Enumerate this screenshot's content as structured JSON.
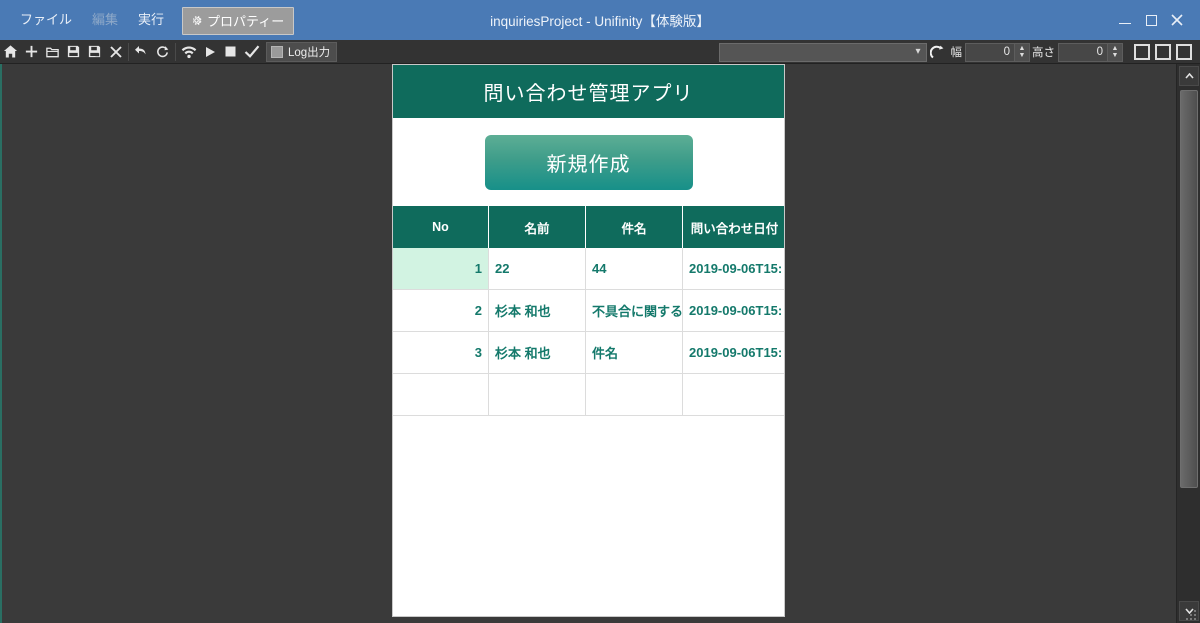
{
  "window": {
    "title": "inquiriesProject - Unifinity【体験版】",
    "accent_color": "#4a7ab5",
    "controls": {
      "minimize": "minimize",
      "maximize": "maximize",
      "close": "close"
    }
  },
  "menubar": {
    "items": [
      {
        "label": "ファイル",
        "enabled": true
      },
      {
        "label": "編集",
        "enabled": false
      },
      {
        "label": "実行",
        "enabled": true
      }
    ],
    "active_button": {
      "label": "プロパティー",
      "icon": "gear-icon"
    }
  },
  "toolbar": {
    "icons": [
      {
        "name": "home-icon",
        "title": "ホーム"
      },
      {
        "name": "plus-icon",
        "title": "新規"
      },
      {
        "name": "folder-icon",
        "title": "開く"
      },
      {
        "name": "save-icon",
        "title": "保存"
      },
      {
        "name": "save-as-icon",
        "title": "名前を付けて保存"
      },
      {
        "name": "close-icon",
        "title": "閉じる"
      },
      {
        "name": "undo-icon",
        "title": "元に戻す"
      },
      {
        "name": "reload-icon",
        "title": "やり直し"
      },
      {
        "name": "wifi-icon",
        "title": "接続"
      },
      {
        "name": "play-icon",
        "title": "実行"
      },
      {
        "name": "stop-icon",
        "title": "停止"
      },
      {
        "name": "check-icon",
        "title": "チェック"
      }
    ],
    "log_button": {
      "label": "Log出力",
      "checked": false
    },
    "dropdown": {
      "value": "",
      "caret": "chevron-down-icon"
    },
    "rotate_icon": "rotate-icon",
    "width_field": {
      "label": "幅",
      "value": "0"
    },
    "height_field": {
      "label": "高さ",
      "value": "0"
    },
    "layout_buttons": [
      "layout-button-1",
      "layout-button-2",
      "layout-button-3"
    ]
  },
  "preview": {
    "header_title": "問い合わせ管理アプリ",
    "header_color": "#0f6b5c",
    "new_button_label": "新規作成",
    "table": {
      "columns": [
        "No",
        "名前",
        "件名",
        "問い合わせ日付"
      ],
      "rows": [
        {
          "no": "1",
          "name": "22",
          "subject": "44",
          "date": "2019-09-06T15:",
          "selected": true
        },
        {
          "no": "2",
          "name": "杉本 和也",
          "subject": "不具合に関する|",
          "date": "2019-09-06T15:",
          "selected": false
        },
        {
          "no": "3",
          "name": "杉本 和也",
          "subject": "件名",
          "date": "2019-09-06T15:",
          "selected": false
        },
        {
          "no": "",
          "name": "",
          "subject": "",
          "date": "",
          "selected": false
        }
      ]
    }
  },
  "scrollbar": {
    "up_arrow": "chevron-up-icon",
    "down_arrow": "chevron-down-icon",
    "resize_grip": "resize-grip"
  }
}
